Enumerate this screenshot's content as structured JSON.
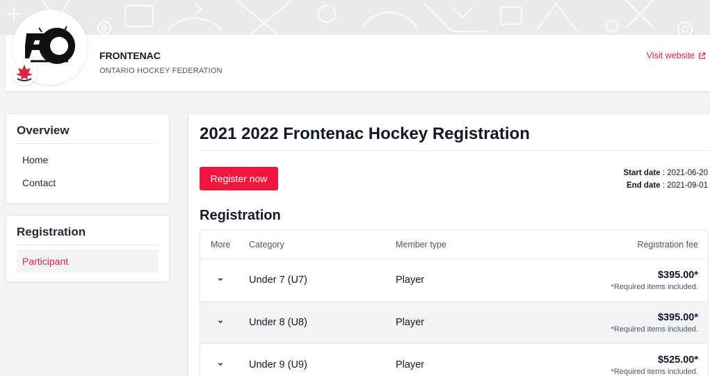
{
  "header": {
    "org_name": "FRONTENAC",
    "org_subtitle": "ONTARIO HOCKEY FEDERATION",
    "visit_label": "Visit website"
  },
  "sidebar": {
    "overview": {
      "title": "Overview",
      "items": [
        {
          "label": "Home"
        },
        {
          "label": "Contact"
        }
      ]
    },
    "registration": {
      "title": "Registration",
      "items": [
        {
          "label": "Participant",
          "active": true
        }
      ]
    }
  },
  "main": {
    "title": "2021 2022 Frontenac Hockey Registration",
    "register_label": "Register now",
    "start_label": "Start date",
    "start_value": "2021-06-20",
    "end_label": "End date",
    "end_value": "2021-09-01",
    "section_title": "Registration",
    "columns": [
      "More",
      "Category",
      "Member type",
      "Registration fee"
    ],
    "rows": [
      {
        "category": "Under 7 (U7)",
        "member_type": "Player",
        "fee": "$395.00*",
        "note": "*Required items included."
      },
      {
        "category": "Under 8 (U8)",
        "member_type": "Player",
        "fee": "$395.00*",
        "note": "*Required items included."
      },
      {
        "category": "Under 9 (U9)",
        "member_type": "Player",
        "fee": "$525.00*",
        "note": "*Required items included."
      }
    ]
  },
  "colors": {
    "accent": "#f0163f",
    "link": "#e11d48",
    "banner": "#e9eaec"
  }
}
